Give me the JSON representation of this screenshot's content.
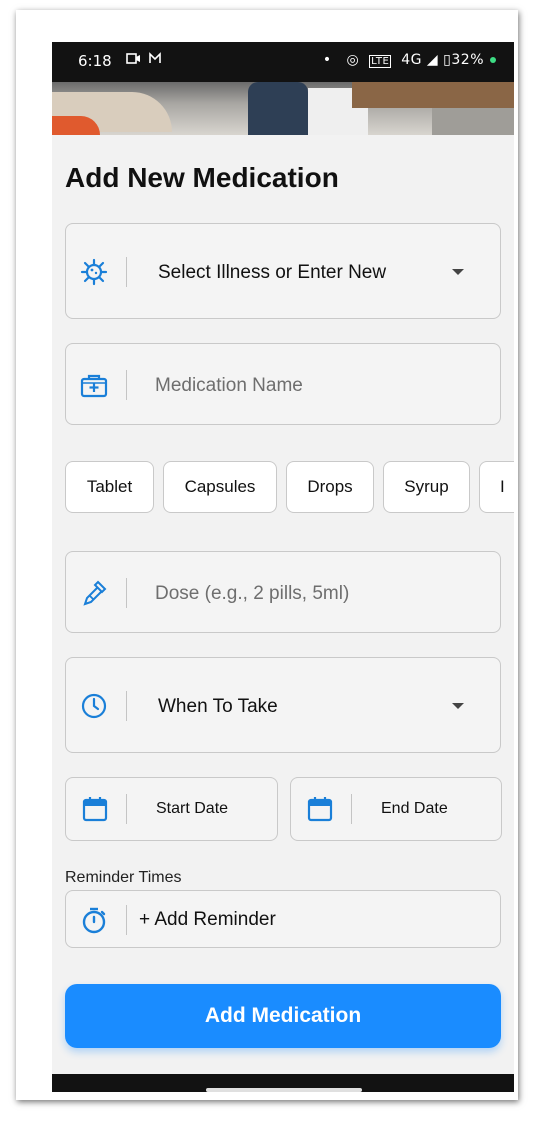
{
  "status_bar": {
    "time": "6:18",
    "network": "4G",
    "battery": "32%"
  },
  "form": {
    "title": "Add New Medication",
    "illness_select": {
      "label": "Select Illness or Enter New"
    },
    "medication_name": {
      "placeholder": "Medication Name"
    },
    "forms": [
      "Tablet",
      "Capsules",
      "Drops",
      "Syrup",
      "I"
    ],
    "dose": {
      "placeholder": "Dose (e.g., 2 pills, 5ml)"
    },
    "when_to_take": {
      "label": "When To Take"
    },
    "start_date": {
      "label": "Start Date"
    },
    "end_date": {
      "label": "End Date"
    },
    "reminder_label": "Reminder Times",
    "add_reminder": "+ Add Reminder",
    "submit": "Add Medication"
  },
  "colors": {
    "accent": "#1a8cff",
    "icon": "#1a7fd8",
    "background": "#f2f2f2"
  },
  "icons": {
    "illness": "virus-icon",
    "medication": "medkit-icon",
    "dose": "dropper-icon",
    "time": "clock-icon",
    "date": "calendar-icon",
    "reminder": "timer-icon"
  }
}
